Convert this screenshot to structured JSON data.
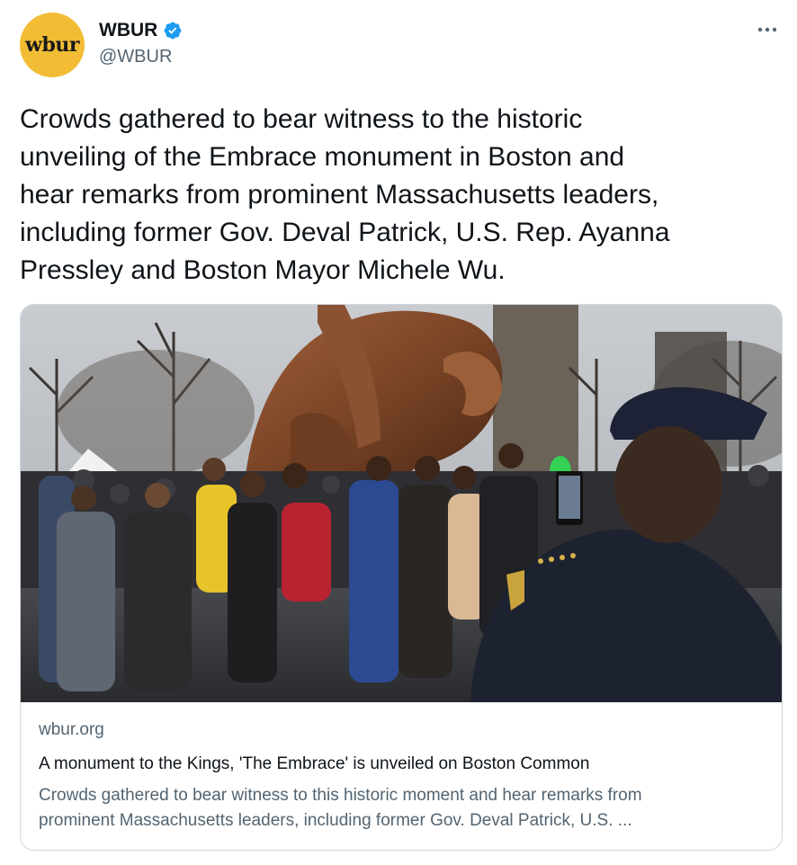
{
  "account": {
    "display_name": "WBUR",
    "handle": "@WBUR",
    "avatar_text": "wbur",
    "avatar_color": "#f2bd35",
    "verified_color": "#1d9bf0"
  },
  "more_icon": "more-horizontal-icon",
  "tweet": {
    "text_lines": [
      "Crowds gathered to bear witness to the historic",
      "unveiling of the Embrace monument in Boston and",
      "hear remarks from prominent Massachusetts leaders,",
      "including former Gov. Deval Patrick, U.S. Rep. Ayanna",
      "Pressley and Boston Mayor Michele Wu."
    ]
  },
  "card": {
    "domain": "wbur.org",
    "title": "A monument to the Kings, 'The Embrace' is unveiled on Boston Common",
    "description_lines": [
      "Crowds gathered to bear witness to this historic moment and hear remarks from",
      "prominent Massachusetts leaders, including former Gov. Deval Patrick, U.S. ..."
    ]
  }
}
